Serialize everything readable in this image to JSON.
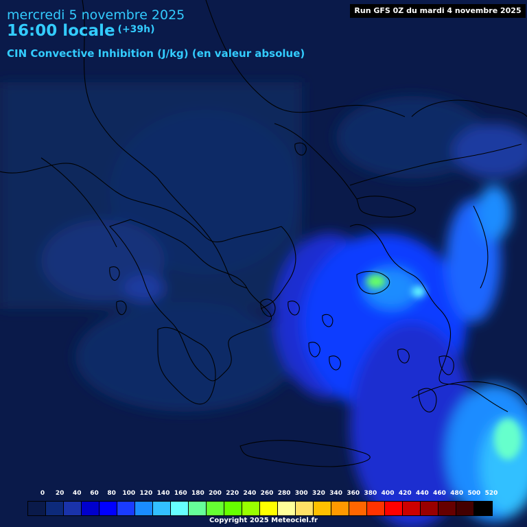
{
  "header": {
    "date": "mercredi 5 novembre 2025",
    "time": "16:00 locale",
    "offset": "(+39h)",
    "variable": "CIN Convective Inhibition (J/kg) (en valeur absolue)",
    "run": "Run GFS 0Z du mardi 4 novembre 2025"
  },
  "legend": {
    "labels": [
      "0",
      "20",
      "40",
      "60",
      "80",
      "100",
      "120",
      "140",
      "160",
      "180",
      "200",
      "220",
      "240",
      "260",
      "280",
      "300",
      "320",
      "340",
      "360",
      "380",
      "400",
      "420",
      "440",
      "460",
      "480",
      "500",
      "520"
    ],
    "colors": [
      "#0a1a4a",
      "#0d2a7a",
      "#1a33aa",
      "#0000cc",
      "#0000ff",
      "#1a3cff",
      "#1a8cff",
      "#33c0ff",
      "#66ffff",
      "#66ff99",
      "#66ff33",
      "#66ff00",
      "#99ff00",
      "#ffff00",
      "#ffff99",
      "#ffe066",
      "#ffc000",
      "#ff9900",
      "#ff6600",
      "#ff3300",
      "#ff0000",
      "#cc0000",
      "#990000",
      "#660000",
      "#440000",
      "#000000"
    ]
  },
  "copyright": "Copyright 2025 Meteociel.fr"
}
